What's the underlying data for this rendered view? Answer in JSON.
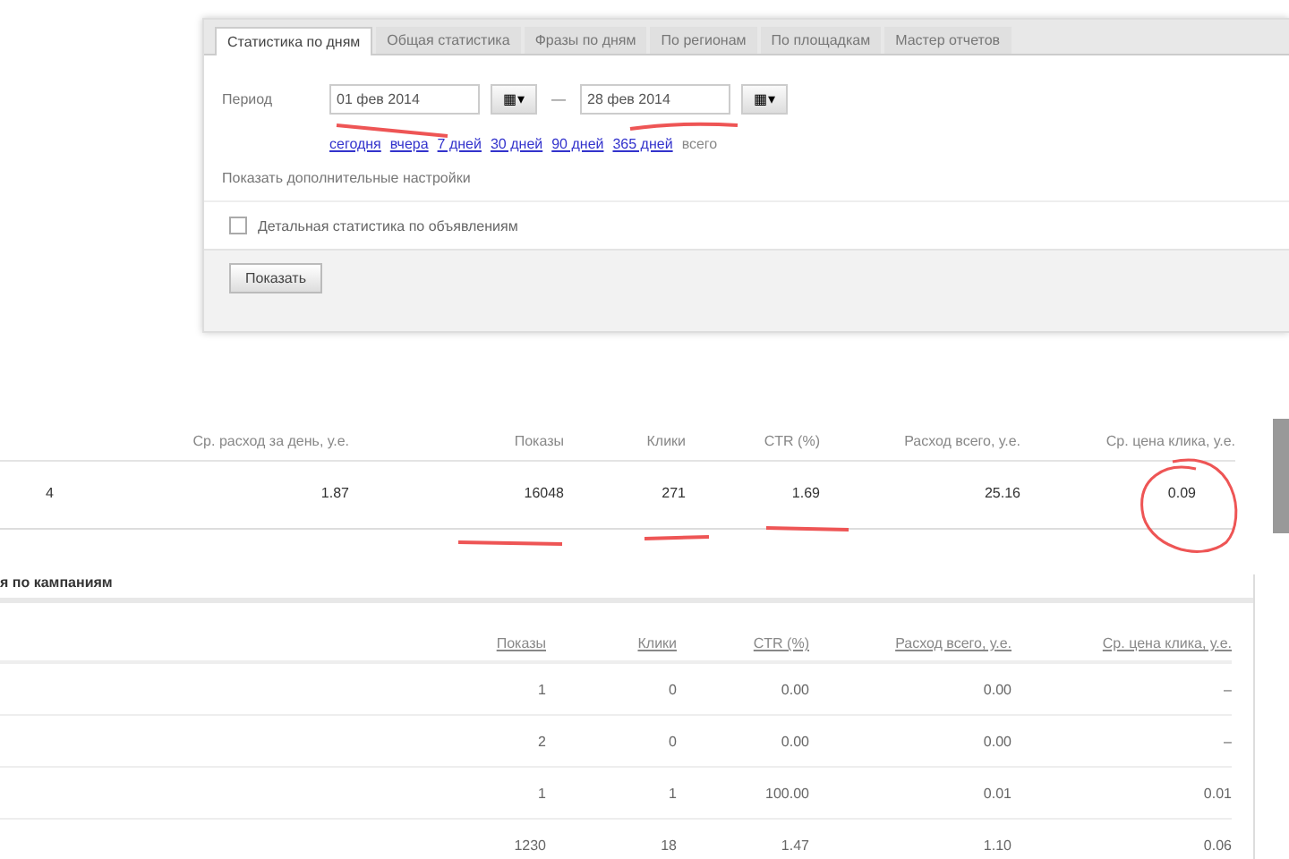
{
  "tabs": [
    {
      "label": "Статистика по дням",
      "selected": true
    },
    {
      "label": "Общая статистика",
      "selected": false
    },
    {
      "label": "Фразы по дням",
      "selected": false
    },
    {
      "label": "По регионам",
      "selected": false
    },
    {
      "label": "По площадкам",
      "selected": false
    },
    {
      "label": "Мастер отчетов",
      "selected": false
    }
  ],
  "period": {
    "label": "Период",
    "from": "01 фев 2014",
    "to": "28 фев 2014",
    "calendar_button": "▦▾",
    "dash": "—",
    "quick_links": [
      "сегодня",
      "вчера",
      "7 дней",
      "30 дней",
      "90 дней",
      "365 дней"
    ],
    "all_label": "всего"
  },
  "more_settings": "Показать дополнительные настройки",
  "detail_checkbox": {
    "label": "Детальная статистика по объявлениям",
    "checked": false
  },
  "show_button": "Показать",
  "summary": {
    "columns": [
      "",
      "Ср. расход за день, у.е.",
      "Показы",
      "Клики",
      "CTR (%)",
      "Расход всего, у.е.",
      "Ср. цена клика, у.е."
    ],
    "row": [
      "4",
      "1.87",
      "16048",
      "271",
      "1.69",
      "25.16",
      "0.09"
    ]
  },
  "section_title": "я по кампаниям",
  "table": {
    "columns": [
      "Показы",
      "Клики",
      "CTR (%)",
      "Расход всего, у.е.",
      "Ср. цена клика, у.е."
    ],
    "rows": [
      [
        "1",
        "0",
        "0.00",
        "0.00",
        "–"
      ],
      [
        "2",
        "0",
        "0.00",
        "0.00",
        "–"
      ],
      [
        "1",
        "1",
        "100.00",
        "0.01",
        "0.01"
      ],
      [
        "1230",
        "18",
        "1.47",
        "1.10",
        "0.06"
      ]
    ]
  }
}
